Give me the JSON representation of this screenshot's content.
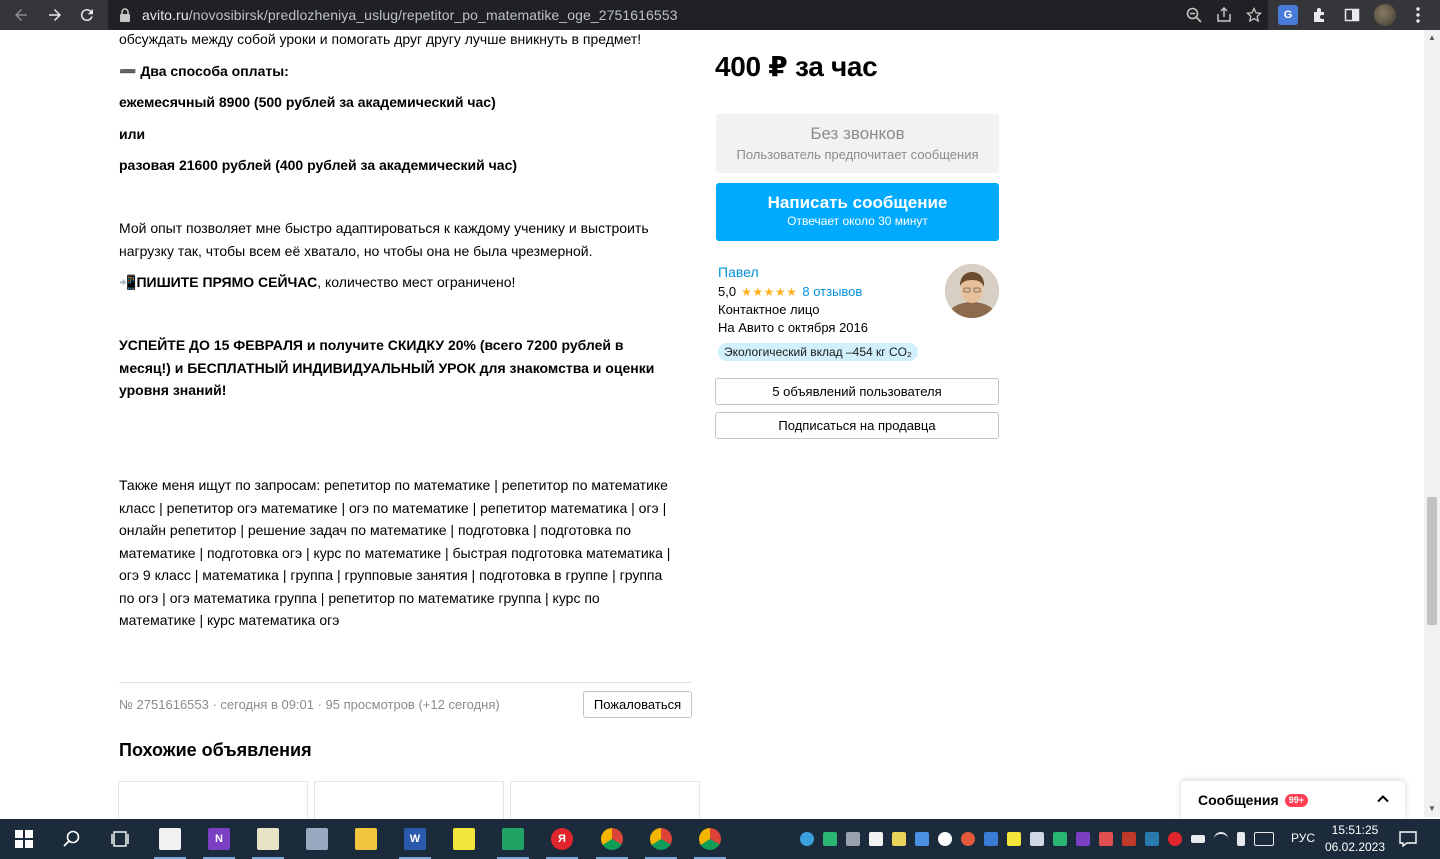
{
  "browser": {
    "url_host": "avito.ru",
    "url_path": "/novosibirsk/predlozheniya_uslug/repetitor_po_matematike_oge_2751616553"
  },
  "description": {
    "p0": "обсуждать между собой уроки и помогать друг другу лучше вникнуть в предмет!",
    "payment_heading": "➖ Два способа оплаты:",
    "payment_monthly": "ежемесячный 8900 (500 рублей за академический час)",
    "payment_or": "или",
    "payment_single": "разовая 21600 рублей (400 рублей за академический час)",
    "experience_line1": "Мой опыт позволяет мне быстро адаптироваться к каждому ученику и выстроить",
    "experience_line2": "нагрузку так, чтобы всем её хватало, но чтобы она не была чрезмерной.",
    "cta_emoji": "📲",
    "cta_bold": "ПИШИТЕ ПРЯМО СЕЙЧАС",
    "cta_rest": ", количество мест ограничено!",
    "promo_line1": "УСПЕЙТЕ ДО 15 ФЕВРАЛЯ и получите СКИДКУ 20% (всего 7200 рублей в",
    "promo_line2": "месяц!) и БЕСПЛАТНЫЙ ИНДИВИДУАЛЬНЫЙ УРОК для знакомства и оценки",
    "promo_line3": "уровня знаний!",
    "search_lines": [
      "Также меня ищут по запросам: репетитор по математике | репетитор по математике",
      "класс | репетитор огэ математике | огэ по математике | репетитор математика | огэ |",
      "онлайн репетитор | решение задач по математике | подготовка | подготовка по",
      "математике | подготовка огэ | курс по математике | быстрая подготовка математика |",
      "огэ 9 класс | математика | группа | групповые занятия | подготовка в группе | группа",
      "по огэ | огэ математика группа | репетитор по математике группа | курс по",
      "математике | курс математика огэ"
    ]
  },
  "sidebar": {
    "price": "400 ₽ за час",
    "no_calls_title": "Без звонков",
    "no_calls_subtitle": "Пользователь предпочитает сообщения",
    "message_button": "Написать сообщение",
    "message_button_sub": "Отвечает около 30 минут",
    "seller_name": "Павел",
    "rating": "5,0",
    "stars": "★★★★★",
    "reviews": "8 отзывов",
    "seller_role": "Контактное лицо",
    "seller_since": "На Авито с октября 2016",
    "eco_badge": "Экологический вклад –454 кг CO₂",
    "user_ads_button": "5 объявлений пользователя",
    "subscribe_button": "Подписаться на продавца"
  },
  "footer": {
    "meta": "№ 2751616553 · сегодня в 09:01 · 95 просмотров (+12 сегодня)",
    "report_button": "Пожаловаться",
    "similar_title": "Похожие объявления"
  },
  "messages_widget": {
    "label": "Сообщения",
    "count": "99+"
  },
  "taskbar": {
    "language": "РУС",
    "time": "15:51:25",
    "date": "06.02.2023"
  }
}
